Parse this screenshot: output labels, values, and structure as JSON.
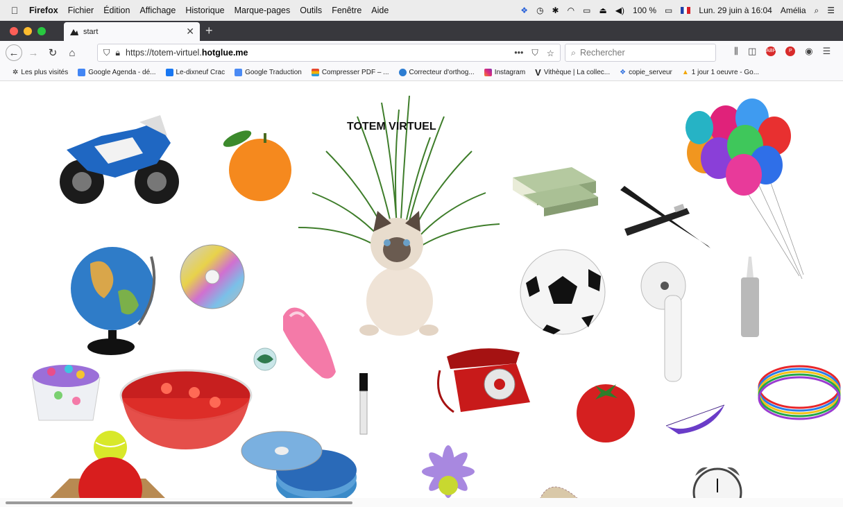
{
  "menubar": {
    "apple_icon": "apple-icon",
    "items": [
      "Firefox",
      "Fichier",
      "Édition",
      "Affichage",
      "Historique",
      "Marque-pages",
      "Outils",
      "Fenêtre",
      "Aide"
    ],
    "battery": "100 %",
    "datetime": "Lun. 29 juin à 16:04",
    "user": "Amélia"
  },
  "tab": {
    "title": "start"
  },
  "navbar": {
    "url_prefix": "https://totem-virtuel.",
    "url_domain": "hotglue.me",
    "search_placeholder": "Rechercher",
    "page_actions": "•••"
  },
  "bookmarks": [
    {
      "label": "Les plus visités",
      "color": "#666"
    },
    {
      "label": "Google Agenda - dé...",
      "color": "#4285f4"
    },
    {
      "label": "Le-dixneuf Crac",
      "color": "#1877f2"
    },
    {
      "label": "Google Traduction",
      "color": "#4a8af4"
    },
    {
      "label": "Compresser PDF – ...",
      "color": "#e6492d"
    },
    {
      "label": "Correcteur d'orthog...",
      "color": "#2d7dd2"
    },
    {
      "label": "Instagram",
      "color": "#c13584"
    },
    {
      "label": "Vithèque | La collec...",
      "color": "#111"
    },
    {
      "label": "copie_serveur",
      "color": "#2f6fdf"
    },
    {
      "label": "1 jour 1 oeuvre - Go...",
      "color": "#f2a600"
    }
  ],
  "page": {
    "title": "TOTEM VIRTUEL"
  }
}
